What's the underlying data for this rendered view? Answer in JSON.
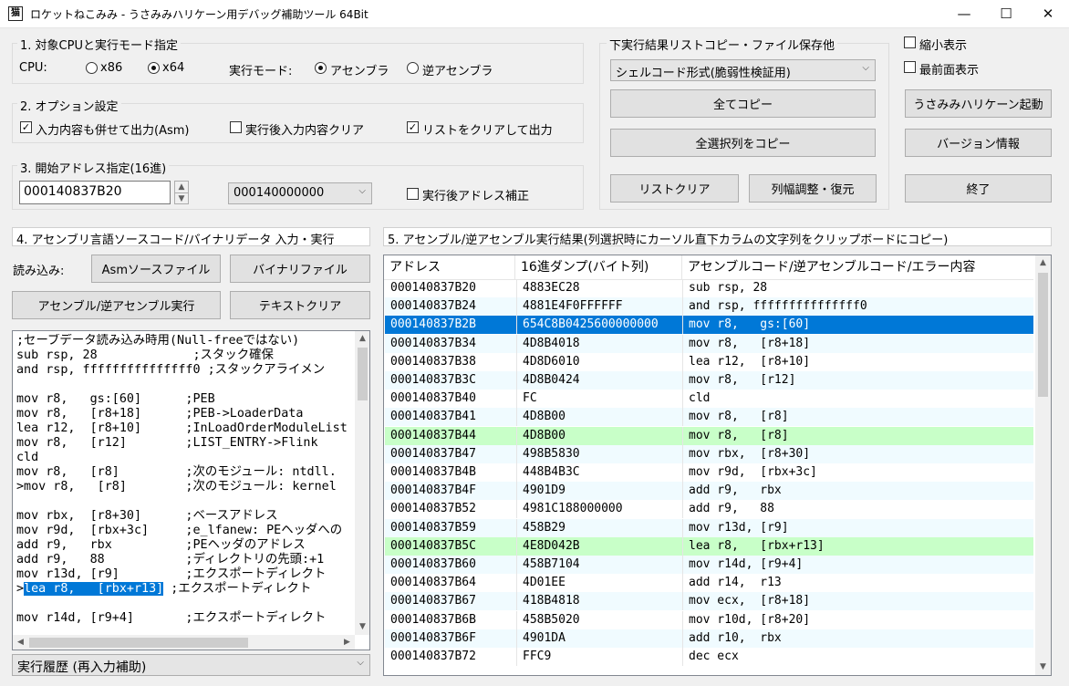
{
  "window": {
    "title": "ロケットねこみみ - うさみみハリケーン用デバッグ補助ツール 64Bit",
    "app_icon": "猫",
    "minimize_glyph": "—",
    "maximize_glyph": "☐",
    "close_glyph": "✕"
  },
  "section1": {
    "title": "1. 対象CPUと実行モード指定",
    "cpu_label": "CPU:",
    "x86_label": "x86",
    "x64_label": "x64",
    "mode_label": "実行モード:",
    "asm_label": "アセンブラ",
    "disasm_label": "逆アセンブラ",
    "cpu_selected": "x64",
    "mode_selected": "アセンブラ"
  },
  "section2": {
    "title": "2. オプション設定",
    "opt1_label": "入力内容も併せて出力(Asm)",
    "opt1_checked": true,
    "opt2_label": "実行後入力内容クリア",
    "opt2_checked": false,
    "opt3_label": "リストをクリアして出力",
    "opt3_checked": true
  },
  "section3": {
    "title": "3. 開始アドレス指定(16進)",
    "address_value": "000140837B20",
    "base_value": "000140000000",
    "correct_label": "実行後アドレス補正",
    "correct_checked": false
  },
  "copy_panel": {
    "title": "下実行結果リストコピー・ファイル保存他",
    "format_value": "シェルコード形式(脆弱性検証用)",
    "copy_all": "全てコピー",
    "copy_column": "全選択列をコピー",
    "list_clear": "リストクリア",
    "col_adjust": "列幅調整・復元"
  },
  "right_panel": {
    "mini_label": "縮小表示",
    "mini_checked": false,
    "topmost_label": "最前面表示",
    "topmost_checked": false,
    "launch": "うさみみハリケーン起動",
    "version": "バージョン情報",
    "exit": "終了"
  },
  "section4": {
    "title": "4. アセンブリ言語ソースコード/バイナリデータ 入力・実行",
    "load_label": "読み込み:",
    "asm_source_btn": "Asmソースファイル",
    "binary_btn": "バイナリファイル",
    "run_btn": "アセンブル/逆アセンブル実行",
    "text_clear_btn": "テキストクリア",
    "history_label": "実行履歴 (再入力補助)",
    "source_lines": [
      ";セーブデータ読み込み時用(Null-freeではない)",
      "sub rsp, 28             ;スタック確保",
      "and rsp, fffffffffffffff0 ;スタックアライメン",
      "",
      "mov r8,   gs:[60]      ;PEB",
      "mov r8,   [r8+18]      ;PEB->LoaderData",
      "lea r12,  [r8+10]      ;InLoadOrderModuleList",
      "mov r8,   [r12]        ;LIST_ENTRY->Flink",
      "cld",
      "mov r8,   [r8]         ;次のモジュール: ntdll.",
      ">mov r8,   [r8]        ;次のモジュール: kernel",
      "",
      "mov rbx,  [r8+30]      ;ベースアドレス",
      "mov r9d,  [rbx+3c]     ;e_lfanew: PEヘッダへの",
      "add r9,   rbx          ;PEヘッダのアドレス",
      "add r9,   88           ;ディレクトリの先頭:+1",
      "mov r13d, [r9]         ;エクスポートディレクト",
      "",
      "",
      "mov r14d, [r9+4]       ;エクスポートディレクト"
    ],
    "selected_line_prefix": ">",
    "selected_line_text": "lea r8,   [rbx+r13]",
    "selected_line_comment": " ;エクスポートディレクト"
  },
  "section5": {
    "title": "5. アセンブル/逆アセンブル実行結果(列選択時にカーソル直下カラムの文字列をクリップボードにコピー)",
    "headers": [
      "アドレス",
      "16進ダンプ(バイト列)",
      "アセンブルコード/逆アセンブルコード/エラー内容"
    ],
    "rows": [
      {
        "addr": "000140837B20",
        "hex": "4883EC28",
        "code": "sub rsp, 28",
        "state": "normal"
      },
      {
        "addr": "000140837B24",
        "hex": "4881E4F0FFFFFF",
        "code": "and rsp, fffffffffffffff0",
        "state": "alt"
      },
      {
        "addr": "000140837B2B",
        "hex": "654C8B0425600000000",
        "code": "mov r8,   gs:[60]",
        "state": "sel"
      },
      {
        "addr": "000140837B34",
        "hex": "4D8B4018",
        "code": "mov r8,   [r8+18]",
        "state": "alt"
      },
      {
        "addr": "000140837B38",
        "hex": "4D8D6010",
        "code": "lea r12,  [r8+10]",
        "state": "normal"
      },
      {
        "addr": "000140837B3C",
        "hex": "4D8B0424",
        "code": "mov r8,   [r12]",
        "state": "alt"
      },
      {
        "addr": "000140837B40",
        "hex": "FC",
        "code": "cld",
        "state": "normal"
      },
      {
        "addr": "000140837B41",
        "hex": "4D8B00",
        "code": "mov r8,   [r8]",
        "state": "alt"
      },
      {
        "addr": "000140837B44",
        "hex": "4D8B00",
        "code": "mov r8,   [r8]",
        "state": "hl"
      },
      {
        "addr": "000140837B47",
        "hex": "498B5830",
        "code": "mov rbx,  [r8+30]",
        "state": "alt"
      },
      {
        "addr": "000140837B4B",
        "hex": "448B4B3C",
        "code": "mov r9d,  [rbx+3c]",
        "state": "normal"
      },
      {
        "addr": "000140837B4F",
        "hex": "4901D9",
        "code": "add r9,   rbx",
        "state": "alt"
      },
      {
        "addr": "000140837B52",
        "hex": "4981C188000000",
        "code": "add r9,   88",
        "state": "normal"
      },
      {
        "addr": "000140837B59",
        "hex": "458B29",
        "code": "mov r13d, [r9]",
        "state": "alt"
      },
      {
        "addr": "000140837B5C",
        "hex": "4E8D042B",
        "code": "lea r8,   [rbx+r13]",
        "state": "hl"
      },
      {
        "addr": "000140837B60",
        "hex": "458B7104",
        "code": "mov r14d, [r9+4]",
        "state": "alt"
      },
      {
        "addr": "000140837B64",
        "hex": "4D01EE",
        "code": "add r14,  r13",
        "state": "normal"
      },
      {
        "addr": "000140837B67",
        "hex": "418B4818",
        "code": "mov ecx,  [r8+18]",
        "state": "alt"
      },
      {
        "addr": "000140837B6B",
        "hex": "458B5020",
        "code": "mov r10d, [r8+20]",
        "state": "normal"
      },
      {
        "addr": "000140837B6F",
        "hex": "4901DA",
        "code": "add r10,  rbx",
        "state": "alt"
      },
      {
        "addr": "000140837B72",
        "hex": "FFC9",
        "code": "dec ecx",
        "state": "normal"
      }
    ]
  },
  "colors": {
    "selection": "#0078d7",
    "highlight_row": "#c8ffc8",
    "alt_row": "#f0fbff"
  }
}
